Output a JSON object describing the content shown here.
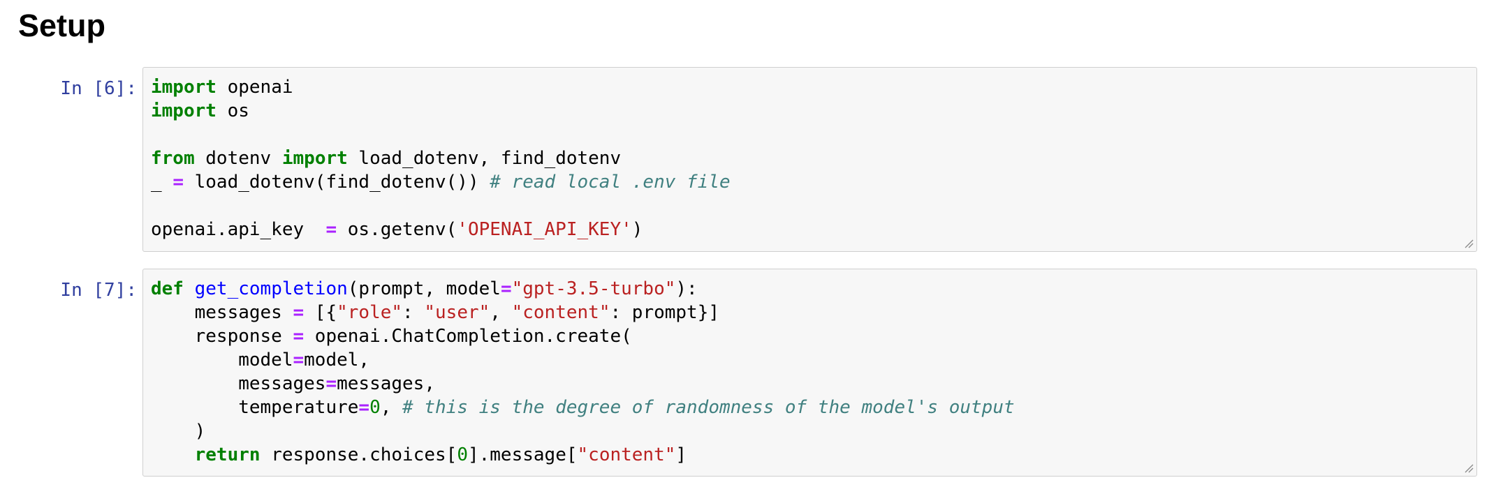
{
  "page": {
    "heading": "Setup"
  },
  "cells": [
    {
      "prompt": "In [6]:",
      "lines": [
        [
          {
            "t": "kw",
            "v": "import"
          },
          {
            "t": "",
            "v": " openai"
          }
        ],
        [
          {
            "t": "kw",
            "v": "import"
          },
          {
            "t": "",
            "v": " os"
          }
        ],
        [],
        [
          {
            "t": "kw",
            "v": "from"
          },
          {
            "t": "",
            "v": " dotenv "
          },
          {
            "t": "kw",
            "v": "import"
          },
          {
            "t": "",
            "v": " load_dotenv, find_dotenv"
          }
        ],
        [
          {
            "t": "",
            "v": "_ "
          },
          {
            "t": "op",
            "v": "="
          },
          {
            "t": "",
            "v": " load_dotenv(find_dotenv()) "
          },
          {
            "t": "cm",
            "v": "# read local .env file"
          }
        ],
        [],
        [
          {
            "t": "",
            "v": "openai.api_key  "
          },
          {
            "t": "op",
            "v": "="
          },
          {
            "t": "",
            "v": " os.getenv("
          },
          {
            "t": "str",
            "v": "'OPENAI_API_KEY'"
          },
          {
            "t": "",
            "v": ")"
          }
        ]
      ]
    },
    {
      "prompt": "In [7]:",
      "lines": [
        [
          {
            "t": "kw",
            "v": "def"
          },
          {
            "t": "",
            "v": " "
          },
          {
            "t": "fn",
            "v": "get_completion"
          },
          {
            "t": "",
            "v": "(prompt, model"
          },
          {
            "t": "op",
            "v": "="
          },
          {
            "t": "str",
            "v": "\"gpt-3.5-turbo\""
          },
          {
            "t": "",
            "v": "):"
          }
        ],
        [
          {
            "t": "",
            "v": "    messages "
          },
          {
            "t": "op",
            "v": "="
          },
          {
            "t": "",
            "v": " [{"
          },
          {
            "t": "str",
            "v": "\"role\""
          },
          {
            "t": "",
            "v": ": "
          },
          {
            "t": "str",
            "v": "\"user\""
          },
          {
            "t": "",
            "v": ", "
          },
          {
            "t": "str",
            "v": "\"content\""
          },
          {
            "t": "",
            "v": ": prompt}]"
          }
        ],
        [
          {
            "t": "",
            "v": "    response "
          },
          {
            "t": "op",
            "v": "="
          },
          {
            "t": "",
            "v": " openai.ChatCompletion.create("
          }
        ],
        [
          {
            "t": "",
            "v": "        model"
          },
          {
            "t": "op",
            "v": "="
          },
          {
            "t": "",
            "v": "model,"
          }
        ],
        [
          {
            "t": "",
            "v": "        messages"
          },
          {
            "t": "op",
            "v": "="
          },
          {
            "t": "",
            "v": "messages,"
          }
        ],
        [
          {
            "t": "",
            "v": "        temperature"
          },
          {
            "t": "op",
            "v": "="
          },
          {
            "t": "num",
            "v": "0"
          },
          {
            "t": "",
            "v": ", "
          },
          {
            "t": "cm",
            "v": "# this is the degree of randomness of the model's output"
          }
        ],
        [
          {
            "t": "",
            "v": "    )"
          }
        ],
        [
          {
            "t": "",
            "v": "    "
          },
          {
            "t": "kw",
            "v": "return"
          },
          {
            "t": "",
            "v": " response.choices["
          },
          {
            "t": "num",
            "v": "0"
          },
          {
            "t": "",
            "v": "].message["
          },
          {
            "t": "str",
            "v": "\"content\""
          },
          {
            "t": "",
            "v": "]"
          }
        ]
      ]
    }
  ],
  "colors": {
    "keyword": "#008000",
    "operator": "#aa22ff",
    "string": "#ba2121",
    "number": "#008000",
    "comment": "#408080",
    "function_name": "#0000ff",
    "prompt": "#303f9f",
    "cell_background": "#f7f7f7",
    "cell_border": "#cfcfcf"
  },
  "icons": {
    "resize_handle": "resize-handle-icon"
  }
}
